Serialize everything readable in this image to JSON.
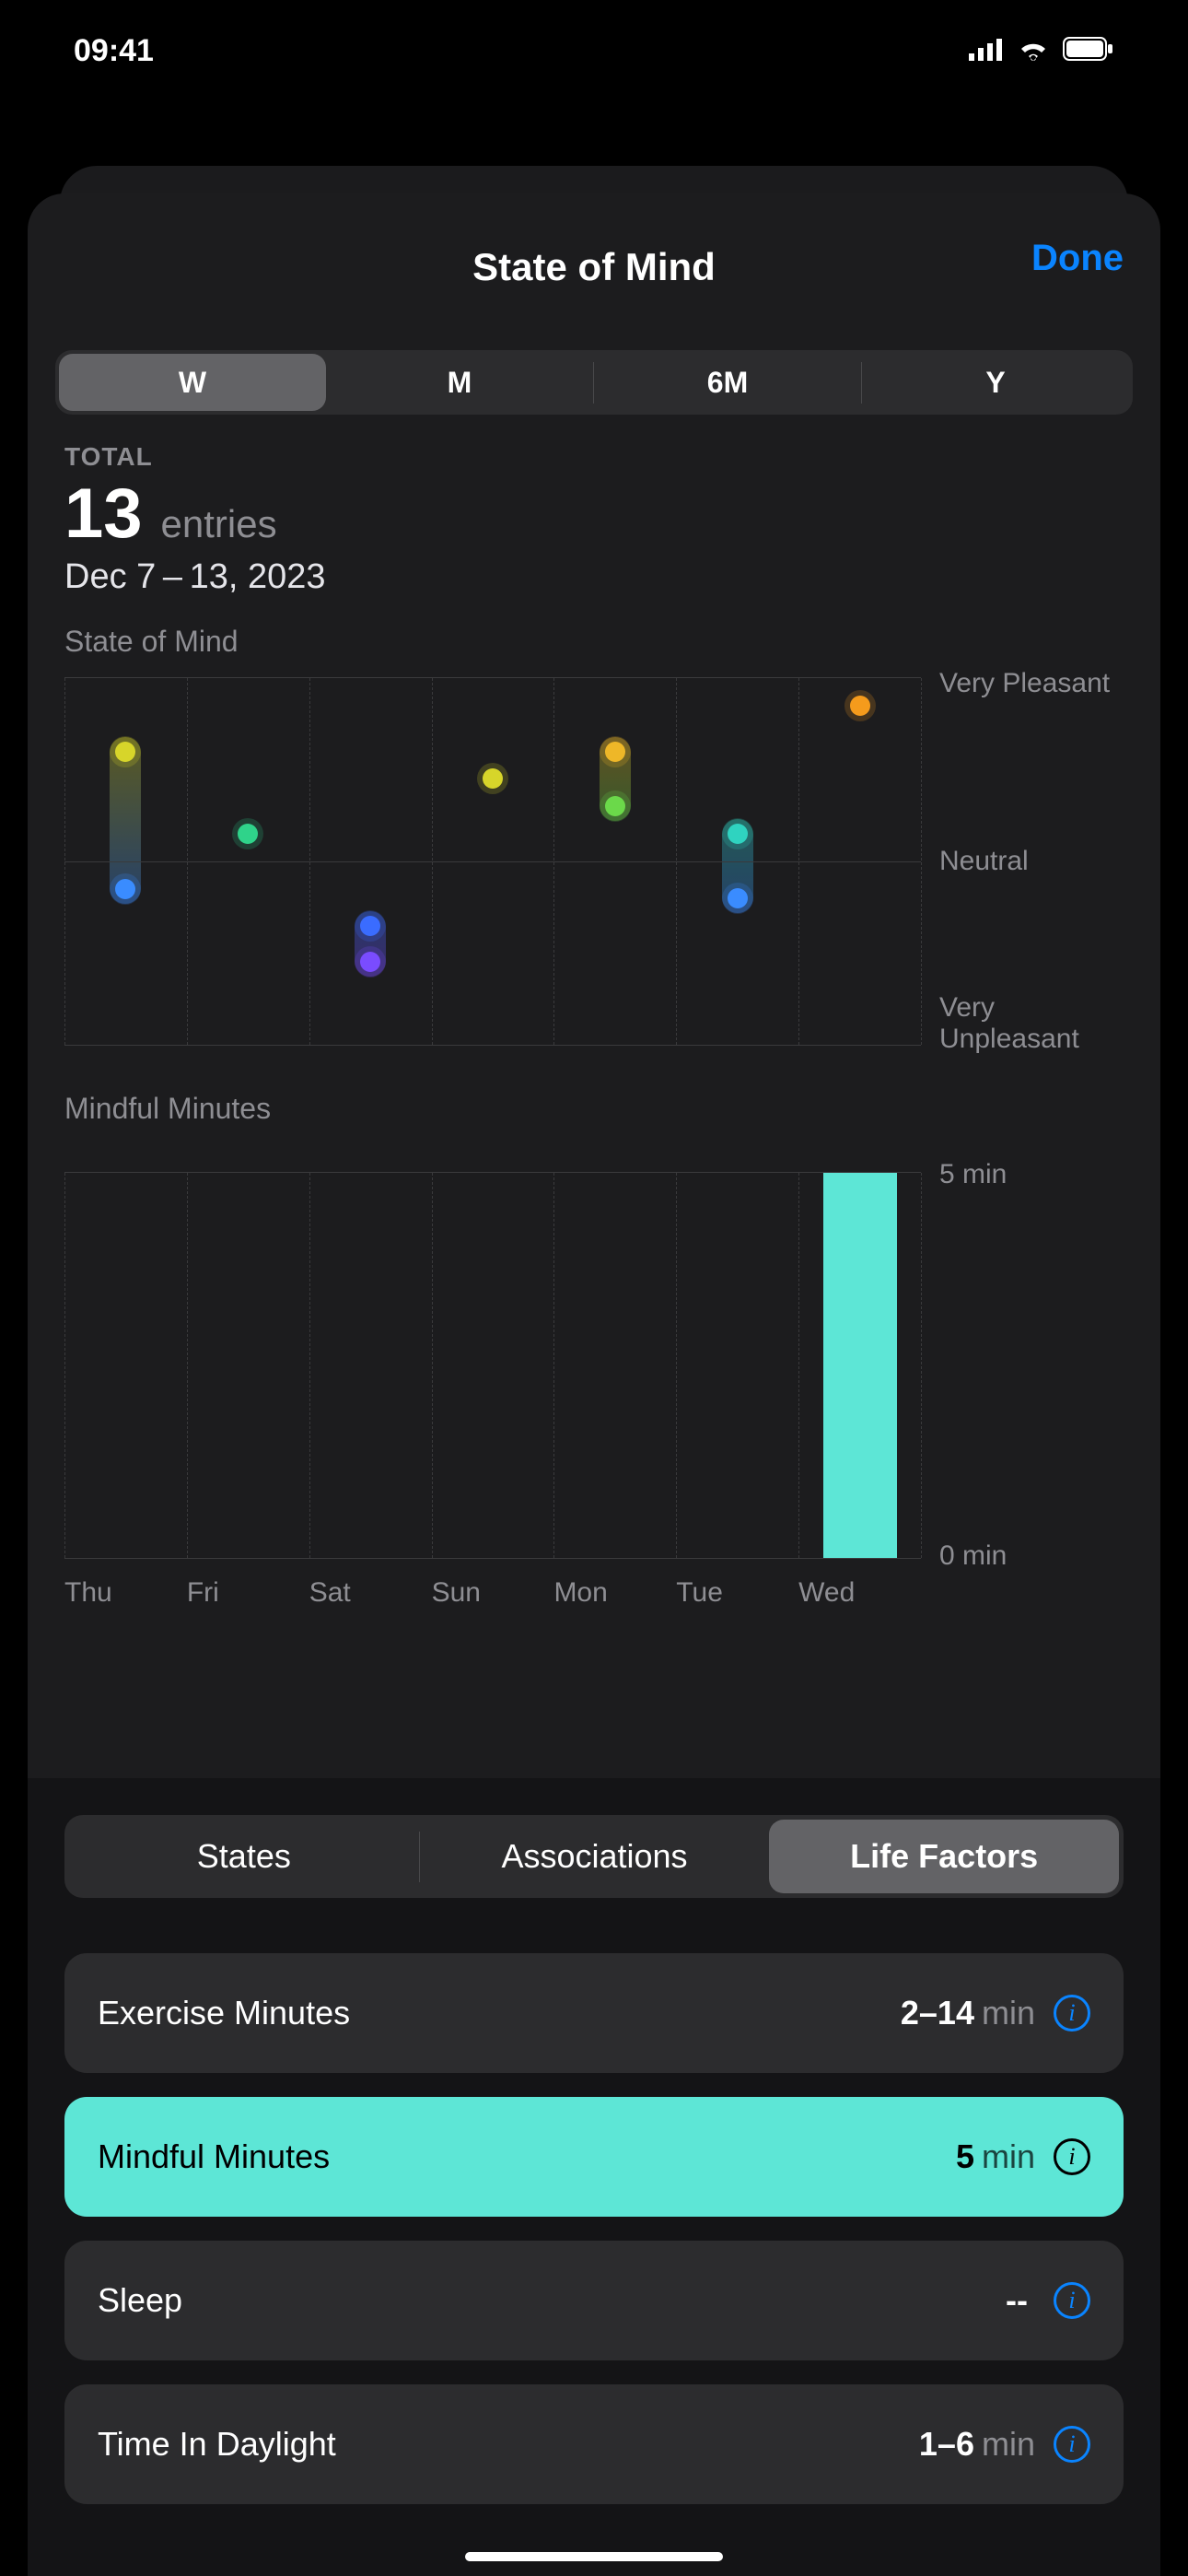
{
  "status": {
    "time": "09:41"
  },
  "header": {
    "title": "State of Mind",
    "done": "Done"
  },
  "range_tabs": [
    "W",
    "M",
    "6M",
    "Y"
  ],
  "range_active": 0,
  "summary": {
    "label": "TOTAL",
    "count": "13",
    "unit": "entries",
    "range": "Dec 7 – 13, 2023"
  },
  "chart_data": [
    {
      "type": "scatter",
      "title": "State of Mind",
      "categories": [
        "Thu",
        "Fri",
        "Sat",
        "Sun",
        "Mon",
        "Tue",
        "Wed"
      ],
      "y_axis_labels": [
        "Very Pleasant",
        "Neutral",
        "Very Unpleasant"
      ],
      "ylim": [
        -1,
        1
      ],
      "series": [
        {
          "day": "Thu",
          "values": [
            0.6,
            -0.15
          ],
          "colors": [
            "#d7d52a",
            "#3a8cff"
          ]
        },
        {
          "day": "Fri",
          "values": [
            0.15
          ],
          "colors": [
            "#2fd38a"
          ]
        },
        {
          "day": "Sat",
          "values": [
            -0.35,
            -0.55
          ],
          "colors": [
            "#3a6cff",
            "#7a4cff"
          ]
        },
        {
          "day": "Sun",
          "values": [
            0.45
          ],
          "colors": [
            "#d7d52a"
          ]
        },
        {
          "day": "Mon",
          "values": [
            0.6,
            0.3
          ],
          "colors": [
            "#eeb728",
            "#6bd94a"
          ]
        },
        {
          "day": "Tue",
          "values": [
            0.15,
            -0.2
          ],
          "colors": [
            "#2fd3c0",
            "#3a8cff"
          ]
        },
        {
          "day": "Wed",
          "values": [
            0.85
          ],
          "colors": [
            "#f59b1c"
          ]
        }
      ]
    },
    {
      "type": "bar",
      "title": "Mindful Minutes",
      "categories": [
        "Thu",
        "Fri",
        "Sat",
        "Sun",
        "Mon",
        "Tue",
        "Wed"
      ],
      "values": [
        0,
        0,
        0,
        0,
        0,
        0,
        5
      ],
      "ylim": [
        0,
        5
      ],
      "ylabel_top": "5 min",
      "ylabel_bot": "0 min"
    }
  ],
  "lower_tabs": [
    "States",
    "Associations",
    "Life Factors"
  ],
  "lower_active": 2,
  "factors": [
    {
      "name": "Exercise Minutes",
      "value": "2–14",
      "unit": "min",
      "active": false
    },
    {
      "name": "Mindful Minutes",
      "value": "5",
      "unit": "min",
      "active": true
    },
    {
      "name": "Sleep",
      "value": "--",
      "unit": "",
      "active": false
    },
    {
      "name": "Time In Daylight",
      "value": "1–6",
      "unit": "min",
      "active": false
    }
  ],
  "colors": {
    "accent_link": "#0a84ff",
    "accent_teal": "#5de6d6"
  }
}
